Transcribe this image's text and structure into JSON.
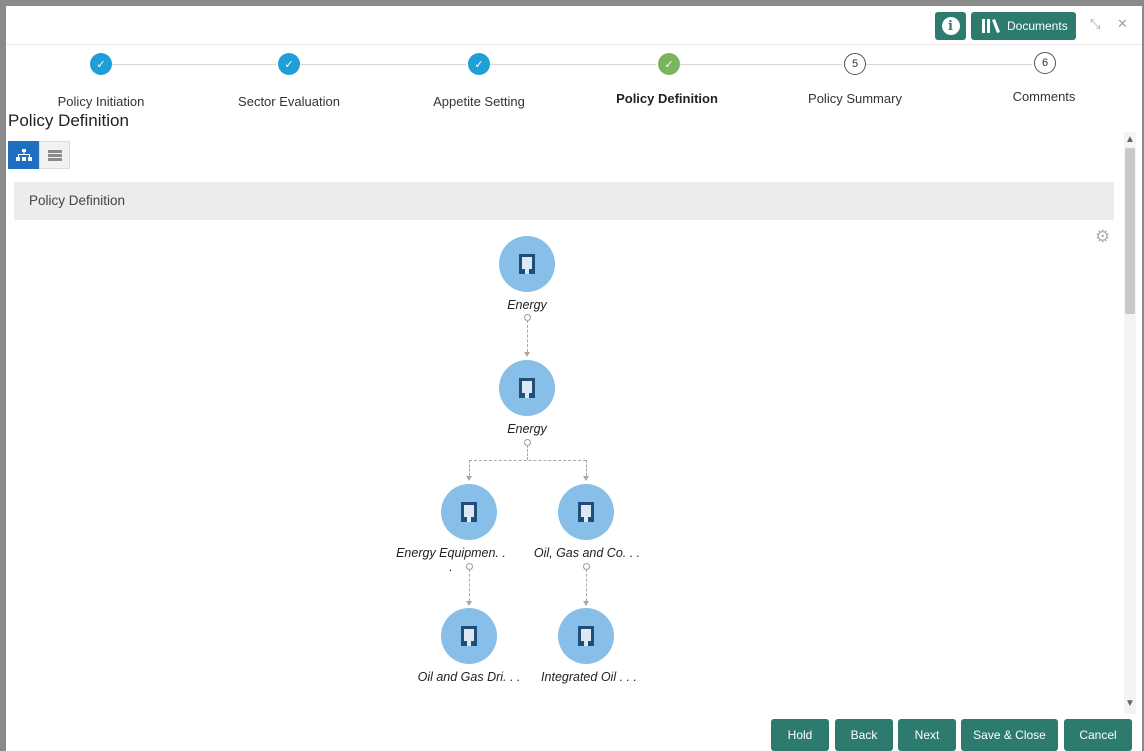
{
  "header": {
    "info_icon": "info-icon",
    "documents_label": "Documents",
    "minimize_icon": "collapse-icon",
    "close_icon": "close-icon"
  },
  "stepper": {
    "steps": [
      {
        "label": "Policy Initiation",
        "state": "done",
        "marker": "✓"
      },
      {
        "label": "Sector Evaluation",
        "state": "done",
        "marker": "✓"
      },
      {
        "label": "Appetite Setting",
        "state": "done",
        "marker": "✓"
      },
      {
        "label": "Policy Definition",
        "state": "current",
        "marker": "✓"
      },
      {
        "label": "Policy Summary",
        "state": "todo",
        "marker": "5"
      },
      {
        "label": "Comments",
        "state": "todo",
        "marker": "6"
      }
    ]
  },
  "page_title": "Policy Definition",
  "view_toggle": {
    "tree_view_icon": "hierarchy-icon",
    "list_view_icon": "list-icon",
    "active": "tree"
  },
  "section_header": "Policy Definition",
  "tree": {
    "nodes": [
      {
        "label": "Energy"
      },
      {
        "label": "Energy"
      },
      {
        "label": "Energy Equipmen. . ."
      },
      {
        "label": "Oil, Gas and Co. . ."
      },
      {
        "label": "Oil and Gas Dri. . ."
      },
      {
        "label": "Integrated Oil . . ."
      }
    ]
  },
  "footer": {
    "hold": "Hold",
    "back": "Back",
    "next": "Next",
    "save_close": "Save & Close",
    "cancel": "Cancel"
  },
  "colors": {
    "primary_button": "#2d7a6f",
    "step_done": "#1f9fd8",
    "step_current": "#7ab55c",
    "node_fill": "#87bfe8",
    "active_toggle": "#1f6fc1"
  }
}
